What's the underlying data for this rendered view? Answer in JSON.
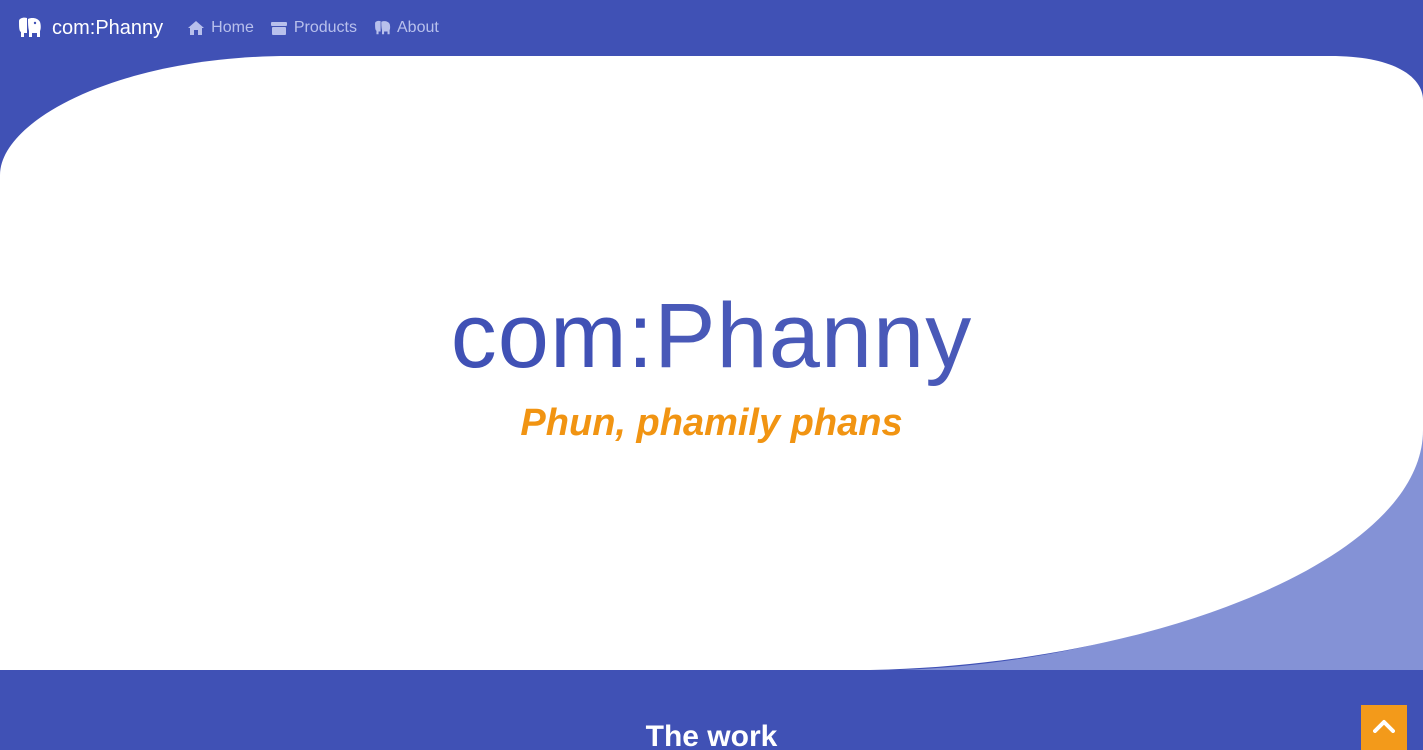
{
  "brand": {
    "name": "com:Phanny",
    "icon": "elephant-icon"
  },
  "nav": {
    "items": [
      {
        "label": "Home",
        "icon": "home-icon"
      },
      {
        "label": "Products",
        "icon": "box-icon"
      },
      {
        "label": "About",
        "icon": "elephant-icon"
      }
    ]
  },
  "hero": {
    "title_prefix": "com:",
    "title_main": "Phanny",
    "tagline": "Phun, phamily phans"
  },
  "section": {
    "title": "The work"
  },
  "colors": {
    "primary": "#4051b5",
    "accent": "#f19412",
    "wave_light": "#8492d6",
    "nav_link": "#b8c0ec"
  },
  "scroll_top": {
    "icon": "chevron-up-icon"
  }
}
